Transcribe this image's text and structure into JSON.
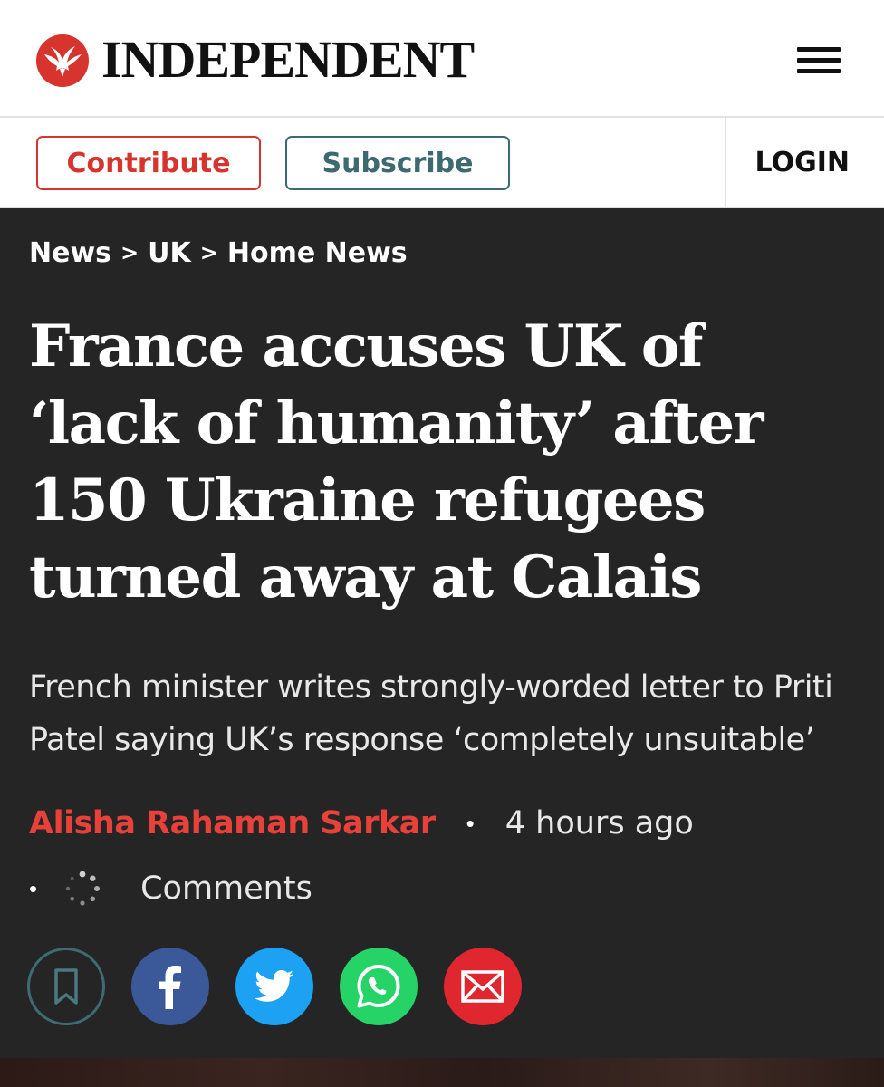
{
  "header": {
    "brand_name": "INDEPENDENT",
    "logo_icon": "eagle-icon",
    "menu_icon": "hamburger-menu-icon"
  },
  "actions": {
    "contribute_label": "Contribute",
    "subscribe_label": "Subscribe",
    "login_label": "LOGIN"
  },
  "breadcrumb": {
    "items": [
      "News",
      "UK",
      "Home News"
    ],
    "separator": ">"
  },
  "article": {
    "headline": "France accuses UK of ‘lack of humanity’ after 150 Ukraine refugees turned away at Calais",
    "standfirst": "French minister writes strongly-worded letter to Priti Patel saying UK’s response ‘completely unsuitable’",
    "author": "Alisha Rahaman Sarkar",
    "published": "4 hours ago",
    "meta_separator": "•",
    "comments_label": "Comments"
  },
  "share": {
    "buttons": [
      "bookmark-icon",
      "facebook-icon",
      "twitter-icon",
      "whatsapp-icon",
      "email-icon"
    ]
  },
  "colors": {
    "accent_red": "#d6342d",
    "author_red": "#e8413a",
    "subscribe_teal": "#3d6a70",
    "page_dark": "#252525",
    "facebook": "#3b5998",
    "twitter": "#1da1f2",
    "whatsapp": "#25d366",
    "email": "#e0262f"
  }
}
